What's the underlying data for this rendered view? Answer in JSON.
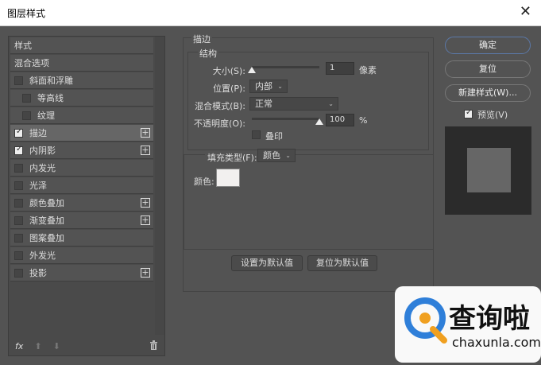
{
  "window": {
    "title": "图层样式",
    "close": "✕"
  },
  "left": {
    "items": [
      {
        "label": "样式",
        "checkbox": false
      },
      {
        "label": "混合选项",
        "checkbox": false
      },
      {
        "label": "斜面和浮雕",
        "checkbox": true,
        "checked": false
      },
      {
        "label": "等高线",
        "checkbox": true,
        "checked": false,
        "indent": true
      },
      {
        "label": "纹理",
        "checkbox": true,
        "checked": false,
        "indent": true
      },
      {
        "label": "描边",
        "checkbox": true,
        "checked": true,
        "plus": true,
        "selected": true
      },
      {
        "label": "内阴影",
        "checkbox": true,
        "checked": true,
        "plus": true
      },
      {
        "label": "内发光",
        "checkbox": true,
        "checked": false
      },
      {
        "label": "光泽",
        "checkbox": true,
        "checked": false
      },
      {
        "label": "颜色叠加",
        "checkbox": true,
        "checked": false,
        "plus": true
      },
      {
        "label": "渐变叠加",
        "checkbox": true,
        "checked": false,
        "plus": true
      },
      {
        "label": "图案叠加",
        "checkbox": true,
        "checked": false
      },
      {
        "label": "外发光",
        "checkbox": true,
        "checked": false
      },
      {
        "label": "投影",
        "checkbox": true,
        "checked": false,
        "plus": true
      }
    ],
    "fx": "fx",
    "up": "⬆",
    "down": "⬇",
    "trash": "🗑"
  },
  "stroke": {
    "title": "描边",
    "structure": "结构",
    "size_label": "大小(S):",
    "size_value": "1",
    "size_unit": "像素",
    "size_fraction": 0.0,
    "position_label": "位置(P):",
    "position_value": "内部",
    "blend_label": "混合模式(B):",
    "blend_value": "正常",
    "opacity_label": "不透明度(O):",
    "opacity_value": "100",
    "opacity_unit": "%",
    "opacity_fraction": 1.0,
    "overprint_label": "叠印",
    "fill_type_label": "填充类型(F):",
    "fill_type_value": "颜色",
    "color_label": "颜色:",
    "color": "#f2f0ef",
    "set_default": "设置为默认值",
    "reset_default": "复位为默认值"
  },
  "right": {
    "ok": "确定",
    "reset": "复位",
    "new_style": "新建样式(W)...",
    "preview_label": "预览(V)"
  },
  "watermark": {
    "text": "查询啦",
    "url": "chaxunla.com"
  }
}
